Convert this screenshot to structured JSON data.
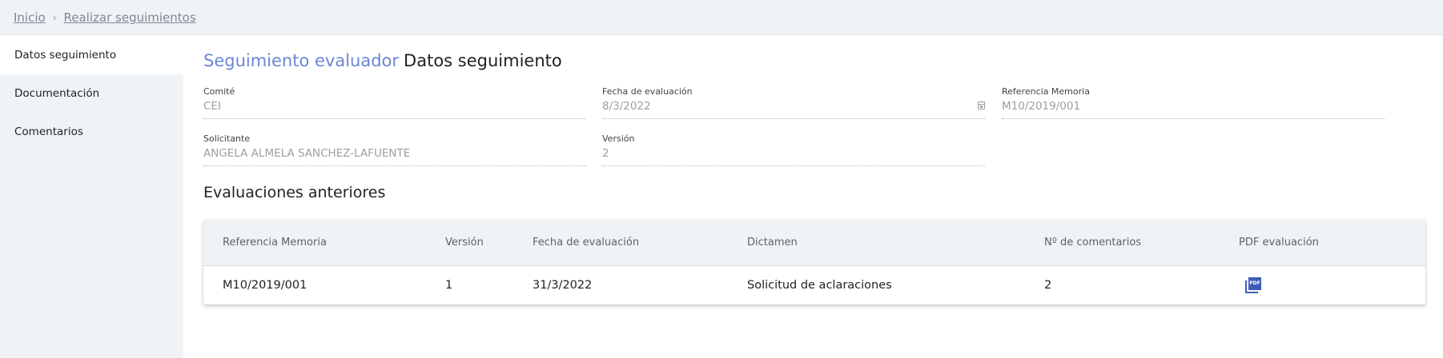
{
  "breadcrumb": {
    "home": "Inicio",
    "separator": "›",
    "current": "Realizar seguimientos"
  },
  "sidebar": {
    "items": [
      {
        "label": "Datos seguimiento",
        "active": true
      },
      {
        "label": "Documentación",
        "active": false
      },
      {
        "label": "Comentarios",
        "active": false
      }
    ]
  },
  "main": {
    "title_primary": "Seguimiento evaluador",
    "title_secondary": "Datos seguimiento",
    "fields": {
      "comite": {
        "label": "Comité",
        "value": "CEI"
      },
      "fecha": {
        "label": "Fecha de evaluación",
        "value": "8/3/2022"
      },
      "referencia": {
        "label": "Referencia Memoria",
        "value": "M10/2019/001"
      },
      "solicitante": {
        "label": "Solicitante",
        "value": "ANGELA ALMELA SANCHEZ-LAFUENTE"
      },
      "version": {
        "label": "Versión",
        "value": "2"
      }
    },
    "section_title": "Evaluaciones anteriores"
  },
  "table": {
    "headers": [
      "Referencia Memoria",
      "Versión",
      "Fecha de evaluación",
      "Dictamen",
      "Nº de comentarios",
      "PDF evaluación"
    ],
    "rows": [
      {
        "referencia": "M10/2019/001",
        "version": "1",
        "fecha": "31/3/2022",
        "dictamen": "Solicitud de aclaraciones",
        "comentarios": "2",
        "pdf_icon": "pdf-file-icon",
        "pdf_icon_text": "PDF"
      }
    ]
  },
  "colors": {
    "accent": "#6b86d6",
    "pdf_icon": "#3f5cb8",
    "sidebar_bg": "#f0f3f6"
  }
}
